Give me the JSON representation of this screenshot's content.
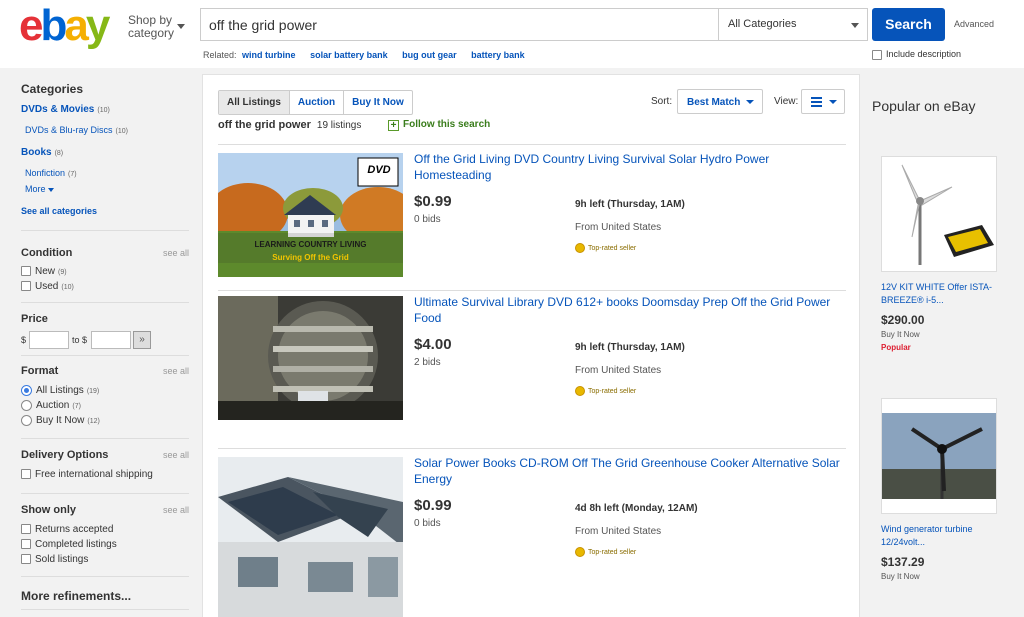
{
  "header": {
    "logo": [
      "e",
      "b",
      "a",
      "y"
    ],
    "shop_by_line1": "Shop by",
    "shop_by_line2": "category",
    "search_value": "off the grid power",
    "category_select": "All Categories",
    "search_button": "Search",
    "advanced": "Advanced",
    "related_label": "Related:",
    "related": [
      "wind turbine",
      "solar battery bank",
      "bug out gear",
      "battery bank"
    ],
    "include_description": "Include description"
  },
  "leftnav": {
    "categories_heading": "Categories",
    "categories": [
      {
        "label": "DVDs & Movies",
        "count": "(10)"
      },
      {
        "label": "DVDs & Blu-ray Discs",
        "count": "(10)"
      },
      {
        "label": "Books",
        "count": "(8)"
      },
      {
        "label": "Nonfiction",
        "count": "(7)"
      }
    ],
    "more": "More",
    "see_all_categories": "See all categories",
    "see_all": "see all",
    "condition_heading": "Condition",
    "condition": [
      {
        "label": "New",
        "count": "(9)"
      },
      {
        "label": "Used",
        "count": "(10)"
      }
    ],
    "price_heading": "Price",
    "price_dollar": "$",
    "price_to": "to $",
    "format_heading": "Format",
    "format": [
      {
        "label": "All Listings",
        "count": "(19)",
        "selected": true
      },
      {
        "label": "Auction",
        "count": "(7)",
        "selected": false
      },
      {
        "label": "Buy It Now",
        "count": "(12)",
        "selected": false
      }
    ],
    "delivery_heading": "Delivery Options",
    "delivery": [
      "Free international shipping"
    ],
    "showonly_heading": "Show only",
    "showonly": [
      "Returns accepted",
      "Completed listings",
      "Sold listings"
    ],
    "more_refinements": "More refinements..."
  },
  "main": {
    "tabs": [
      "All Listings",
      "Auction",
      "Buy It Now"
    ],
    "query": "off the grid power",
    "listing_count": "19 listings",
    "follow": "Follow this search",
    "sort_label": "Sort:",
    "sort_value": "Best Match",
    "view_label": "View:",
    "items": [
      {
        "title": "Off the Grid Living DVD Country Living Survival Solar Hydro Power Homesteading",
        "price": "$0.99",
        "bids": "0 bids",
        "time_left": "9h left (Thursday, 1AM)",
        "from": "From United States",
        "seller": "Top-rated seller",
        "thumb_caption1": "LEARNING COUNTRY LIVING",
        "thumb_caption2": "Surving Off the Grid",
        "thumb_badge": "DVD"
      },
      {
        "title": "Ultimate Survival Library DVD 612+ books Doomsday Prep Off the Grid Power Food",
        "price": "$4.00",
        "bids": "2 bids",
        "time_left": "9h left (Thursday, 1AM)",
        "from": "From United States",
        "seller": "Top-rated seller"
      },
      {
        "title": "Solar Power Books CD-ROM Off The Grid Greenhouse Cooker Alternative Solar Energy",
        "price": "$0.99",
        "bids": "0 bids",
        "time_left": "4d 8h left (Monday, 12AM)",
        "from": "From United States",
        "seller": "Top-rated seller"
      }
    ]
  },
  "popular": {
    "heading": "Popular on eBay",
    "cards": [
      {
        "title": "12V KIT WHITE Offer ISTA-BREEZE® i-5...",
        "price": "$290.00",
        "buy": "Buy It Now",
        "tag": "Popular"
      },
      {
        "title": "Wind generator turbine 12/24volt...",
        "price": "$137.29",
        "buy": "Buy It Now",
        "tag": ""
      }
    ]
  },
  "colors": {
    "ebay_e": "#e53238",
    "ebay_b": "#0064d2",
    "ebay_a": "#f5af02",
    "ebay_y": "#86b817",
    "link": "#0654ba",
    "search_button": "#0654ba",
    "popular_tag": "#dd1e31"
  }
}
